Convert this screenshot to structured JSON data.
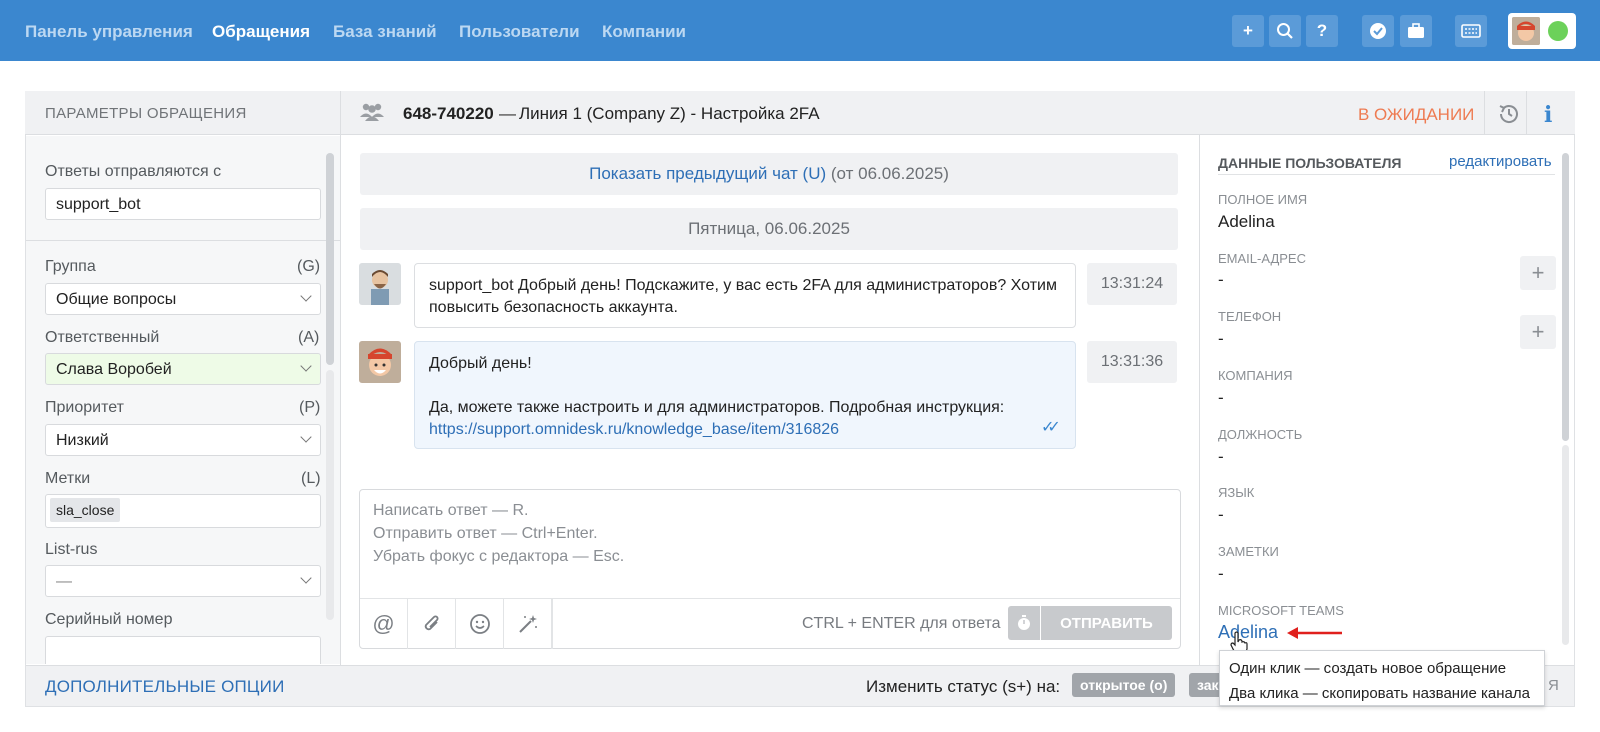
{
  "nav": {
    "items": [
      "Панель управления",
      "Обращения",
      "База знаний",
      "Пользователи",
      "Компании"
    ]
  },
  "toolbar": {
    "icons": [
      "plus-icon",
      "search-icon",
      "help-icon",
      "shield-check-icon",
      "briefcase-icon",
      "keyboard-icon"
    ],
    "status_color": "#6cd15a"
  },
  "left": {
    "header": "ПАРАМЕТРЫ ОБРАЩЕНИЯ",
    "reply_from_label": "Ответы отправляются с",
    "reply_from_value": "support_bot",
    "group": {
      "label": "Группа",
      "key": "(G)",
      "value": "Общие вопросы"
    },
    "assignee": {
      "label": "Ответственный",
      "key": "(A)",
      "value": "Слава Воробей"
    },
    "priority": {
      "label": "Приоритет",
      "key": "(P)",
      "value": "Низкий"
    },
    "tags": {
      "label": "Метки",
      "key": "(L)",
      "chip": "sla_close"
    },
    "list_rus": {
      "label": "List-rus",
      "value": "—"
    },
    "serial": {
      "label": "Серийный номер"
    }
  },
  "ticket": {
    "id": "648-740220",
    "dash": "—",
    "title": "Линия 1 (Company Z) - Настройка 2FA",
    "status": "В ОЖИДАНИИ",
    "status_color": "#ee7b52"
  },
  "chat": {
    "prev_link": "Показать предыдущий чат (U)",
    "prev_date": "(от 06.06.2025)",
    "day": "Пятница, 06.06.2025",
    "messages": [
      {
        "author": "support_bot",
        "text": "Добрый день! Подскажите, у вас есть 2FA для администраторов? Хотим повысить безопасность аккаунта.",
        "time": "13:31:24"
      },
      {
        "line1": "Добрый день!",
        "line2": "Да, можете также настроить и для администраторов. Подробная инструкция:",
        "link": "https://support.omnidesk.ru/knowledge_base/item/316826",
        "time": "13:31:36"
      }
    ]
  },
  "composer": {
    "placeholder1": "Написать ответ — R.",
    "placeholder2": "Отправить ответ — Ctrl+Enter.",
    "placeholder3": "Убрать фокус с редактора — Esc.",
    "hint": "CTRL + ENTER для ответа",
    "send": "ОТПРАВИТЬ"
  },
  "user": {
    "header": "ДАННЫЕ ПОЛЬЗОВАТЕЛЯ",
    "edit": "редактировать",
    "fields": [
      {
        "label": "ПОЛНОЕ ИМЯ",
        "value": "Adelina"
      },
      {
        "label": "EMAIL-АДРЕС",
        "value": "-"
      },
      {
        "label": "ТЕЛЕФОН",
        "value": "-"
      },
      {
        "label": "КОМПАНИЯ",
        "value": "-"
      },
      {
        "label": "ДОЛЖНОСТЬ",
        "value": "-"
      },
      {
        "label": "ЯЗЫК",
        "value": "-"
      },
      {
        "label": "ЗАМЕТКИ",
        "value": "-"
      },
      {
        "label": "MICROSOFT TEAMS",
        "value": "Adelina"
      }
    ]
  },
  "tooltip": {
    "line1": "Один клик — создать новое обращение",
    "line2": "Два клика — скопировать название канала"
  },
  "footer": {
    "options": "ДОПОЛНИТЕЛЬНЫЕ ОПЦИИ",
    "change_status": "Изменить статус (s+) на:",
    "pill_open": "открытое (o)",
    "pill_next": "зак",
    "tail": "Я"
  }
}
